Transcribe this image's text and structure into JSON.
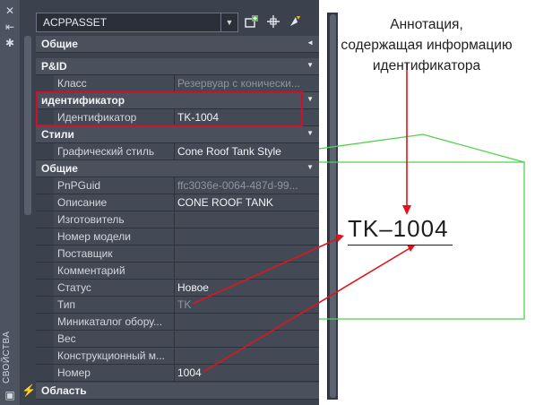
{
  "strip": {
    "label": "СВОЙСТВА"
  },
  "toolbar": {
    "selected": "ACPPASSET"
  },
  "rows": [
    {
      "kind": "cat",
      "label": "Общие",
      "chev": "◄"
    },
    {
      "kind": "cat",
      "label": "P&ID",
      "chev": "▼"
    },
    {
      "kind": "prop",
      "name": "Класс",
      "value": "Резервуар с конически...",
      "dim": true
    },
    {
      "kind": "cat",
      "label": "идентификатор",
      "chev": "▼"
    },
    {
      "kind": "prop",
      "name": "Идентификатор",
      "value": "TK-1004"
    },
    {
      "kind": "cat",
      "label": "Стили",
      "chev": "▼"
    },
    {
      "kind": "prop",
      "name": "Графический стиль",
      "value": "Cone Roof Tank Style"
    },
    {
      "kind": "cat",
      "label": "Общие",
      "chev": "▼"
    },
    {
      "kind": "prop",
      "name": "PnPGuid",
      "value": "ffc3036e-0064-487d-99...",
      "dim": true
    },
    {
      "kind": "prop",
      "name": "Описание",
      "value": "CONE ROOF TANK"
    },
    {
      "kind": "prop",
      "name": "Изготовитель",
      "value": ""
    },
    {
      "kind": "prop",
      "name": "Номер модели",
      "value": ""
    },
    {
      "kind": "prop",
      "name": "Поставщик",
      "value": ""
    },
    {
      "kind": "prop",
      "name": "Комментарий",
      "value": ""
    },
    {
      "kind": "prop",
      "name": "Статус",
      "value": "Новое"
    },
    {
      "kind": "prop",
      "name": "Тип",
      "value": "TK",
      "dim": true
    },
    {
      "kind": "prop",
      "name": "Миникаталог обору...",
      "value": ""
    },
    {
      "kind": "prop",
      "name": "Вес",
      "value": ""
    },
    {
      "kind": "prop",
      "name": "Конструкционный м...",
      "value": ""
    },
    {
      "kind": "prop",
      "name": "Номер",
      "value": "1004"
    },
    {
      "kind": "cat",
      "label": "Область",
      "chev": "",
      "bolt": true
    }
  ],
  "callout": {
    "line1": "Аннотация,",
    "line2": "содержащая информацию",
    "line3": "идентификатора"
  },
  "drawing": {
    "annotation": "TK–1004"
  },
  "colors": {
    "panel": "#3b414d",
    "category": "#4a505c",
    "highlight": "#d0102a",
    "tank": "#4fd24f",
    "arrow": "#e0141e"
  }
}
